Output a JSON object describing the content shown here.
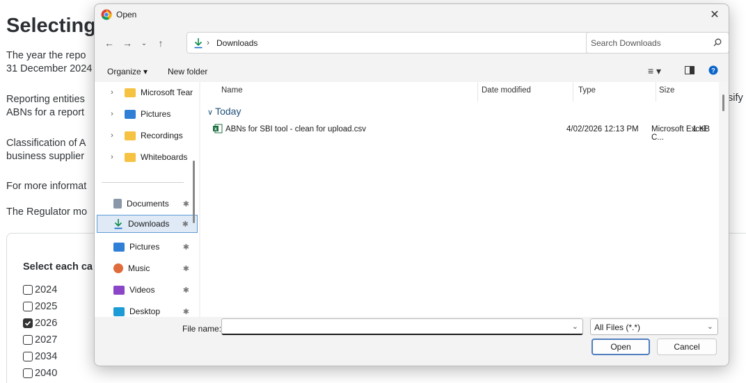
{
  "page": {
    "title": "Selecting",
    "paragraphs": [
      "The year the repo",
      "31 December 2024",
      "Reporting entities",
      "ABNs for a report",
      "Classification of A",
      "business supplier",
      "For more informat",
      "The Regulator mo"
    ],
    "right_fragment": "sify",
    "select_label": "Select each ca",
    "years": [
      {
        "label": "2024",
        "checked": false
      },
      {
        "label": "2025",
        "checked": false
      },
      {
        "label": "2026",
        "checked": true
      },
      {
        "label": "2027",
        "checked": false
      },
      {
        "label": "2034",
        "checked": false
      },
      {
        "label": "2040",
        "checked": false
      }
    ]
  },
  "dialog": {
    "title": "Open",
    "address": {
      "crumb": "Downloads"
    },
    "search": {
      "placeholder": "Search Downloads"
    },
    "command_bar": {
      "organize": "Organize ▾",
      "new_folder": "New folder"
    },
    "nav_items": [
      {
        "label": "Microsoft Tear",
        "icon": "folder-icon",
        "expandable": true
      },
      {
        "label": "Pictures",
        "icon": "pictures-icon",
        "expandable": true
      },
      {
        "label": "Recordings",
        "icon": "folder-icon",
        "expandable": true
      },
      {
        "label": "Whiteboards",
        "icon": "folder-icon",
        "expandable": true
      },
      {
        "label": "Documents",
        "icon": "documents-icon",
        "pinned": true
      },
      {
        "label": "Downloads",
        "icon": "downloads-icon",
        "pinned": true,
        "selected": true
      },
      {
        "label": "Pictures",
        "icon": "pictures-icon",
        "pinned": true
      },
      {
        "label": "Music",
        "icon": "music-icon",
        "pinned": true
      },
      {
        "label": "Videos",
        "icon": "videos-icon",
        "pinned": true
      },
      {
        "label": "Desktop",
        "icon": "desktop-icon",
        "pinned": true
      }
    ],
    "columns": {
      "name": "Name",
      "date": "Date modified",
      "type": "Type",
      "size": "Size"
    },
    "group": "Today",
    "files": [
      {
        "name": "ABNs for SBI tool - clean for upload.csv",
        "date": "4/02/2026 12:13 PM",
        "type": "Microsoft Excel C...",
        "size": "1 KB"
      }
    ],
    "file_name": {
      "label": "File name:",
      "value": ""
    },
    "filter": "All Files (*.*)",
    "buttons": {
      "open": "Open",
      "cancel": "Cancel"
    }
  },
  "colors": {
    "accent": "#0a64c9",
    "selected_bg": "#dfeaf6",
    "folder": "#f5c242"
  }
}
